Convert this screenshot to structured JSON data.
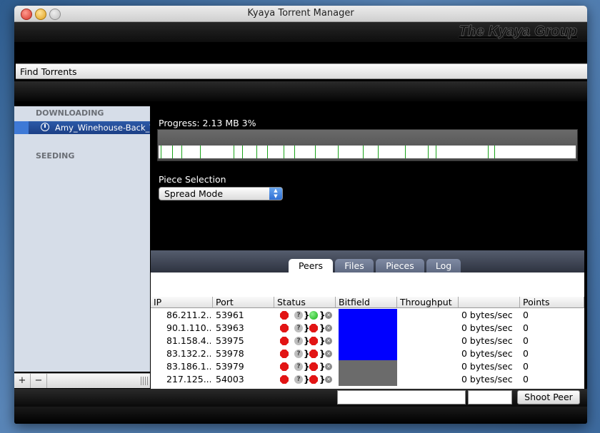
{
  "window": {
    "title": "Kyaya Torrent Manager"
  },
  "brand": {
    "text": "The Kyaya Group"
  },
  "findbar": {
    "label": "Find Torrents"
  },
  "sidebar": {
    "downloading_header": "DOWNLOADING",
    "seeding_header": "SEEDING",
    "items": [
      {
        "label": "Amy_Winehouse-Back_To_Black"
      }
    ],
    "add_label": "+",
    "remove_label": "−"
  },
  "progress": {
    "label": "Progress: 2.13 MB 3%",
    "fraction": 0.03
  },
  "pieces": {
    "section_label": "Piece Selection",
    "mode_selected": "Spread Mode",
    "marks_fraction": [
      0.005,
      0.032,
      0.055,
      0.1,
      0.18,
      0.2,
      0.235,
      0.26,
      0.3,
      0.325,
      0.375,
      0.43,
      0.49,
      0.525,
      0.59,
      0.645,
      0.665,
      0.79,
      0.805
    ]
  },
  "tabs": [
    {
      "label": "Peers",
      "active": true
    },
    {
      "label": "Files",
      "active": false
    },
    {
      "label": "Pieces",
      "active": false
    },
    {
      "label": "Log",
      "active": false
    }
  ],
  "peers": {
    "columns": [
      "IP",
      "Port",
      "Status",
      "Bitfield",
      "Throughput",
      "",
      "Points"
    ],
    "rows": [
      {
        "ip": "86.211.2...",
        "port": "53961",
        "status": [
          "stop",
          "question",
          "green",
          "x"
        ],
        "bitfield": "#0000ff",
        "throughput": "0 bytes/sec",
        "points": "0"
      },
      {
        "ip": "90.1.110....",
        "port": "53963",
        "status": [
          "stop",
          "question",
          "red",
          "x"
        ],
        "bitfield": "#0000ff",
        "throughput": "0 bytes/sec",
        "points": "0"
      },
      {
        "ip": "81.158.4...",
        "port": "53975",
        "status": [
          "stop",
          "question",
          "red",
          "x"
        ],
        "bitfield": "#0000ff",
        "throughput": "0 bytes/sec",
        "points": "0"
      },
      {
        "ip": "83.132.2...",
        "port": "53978",
        "status": [
          "stop",
          "question",
          "red",
          "x"
        ],
        "bitfield": "#0000ff",
        "throughput": "0 bytes/sec",
        "points": "0"
      },
      {
        "ip": "83.186.1...",
        "port": "53979",
        "status": [
          "stop",
          "question",
          "red",
          "x"
        ],
        "bitfield": "#6b6b6b",
        "throughput": "0 bytes/sec",
        "points": "0"
      },
      {
        "ip": "217.125....",
        "port": "54003",
        "status": [
          "stop",
          "question",
          "red",
          "x"
        ],
        "bitfield": "#6b6b6b",
        "throughput": "0 bytes/sec",
        "points": "0"
      }
    ]
  },
  "bottom": {
    "shoot_label": "Shoot Peer",
    "field1_value": "",
    "field2_value": ""
  }
}
